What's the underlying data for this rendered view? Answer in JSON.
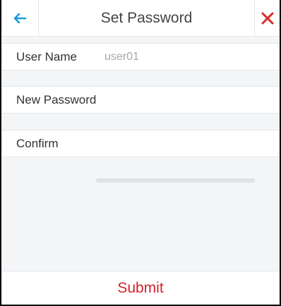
{
  "header": {
    "title": "Set Password",
    "back_icon": "arrow-left-icon",
    "close_icon": "close-icon"
  },
  "form": {
    "username_label": "User Name",
    "username_value": "user01",
    "new_password_label": "New Password",
    "new_password_value": "",
    "confirm_label": "Confirm",
    "confirm_value": ""
  },
  "actions": {
    "submit_label": "Submit"
  },
  "colors": {
    "accent": "#1a9bd7",
    "danger": "#d92b2b",
    "submit": "#d2212b"
  }
}
